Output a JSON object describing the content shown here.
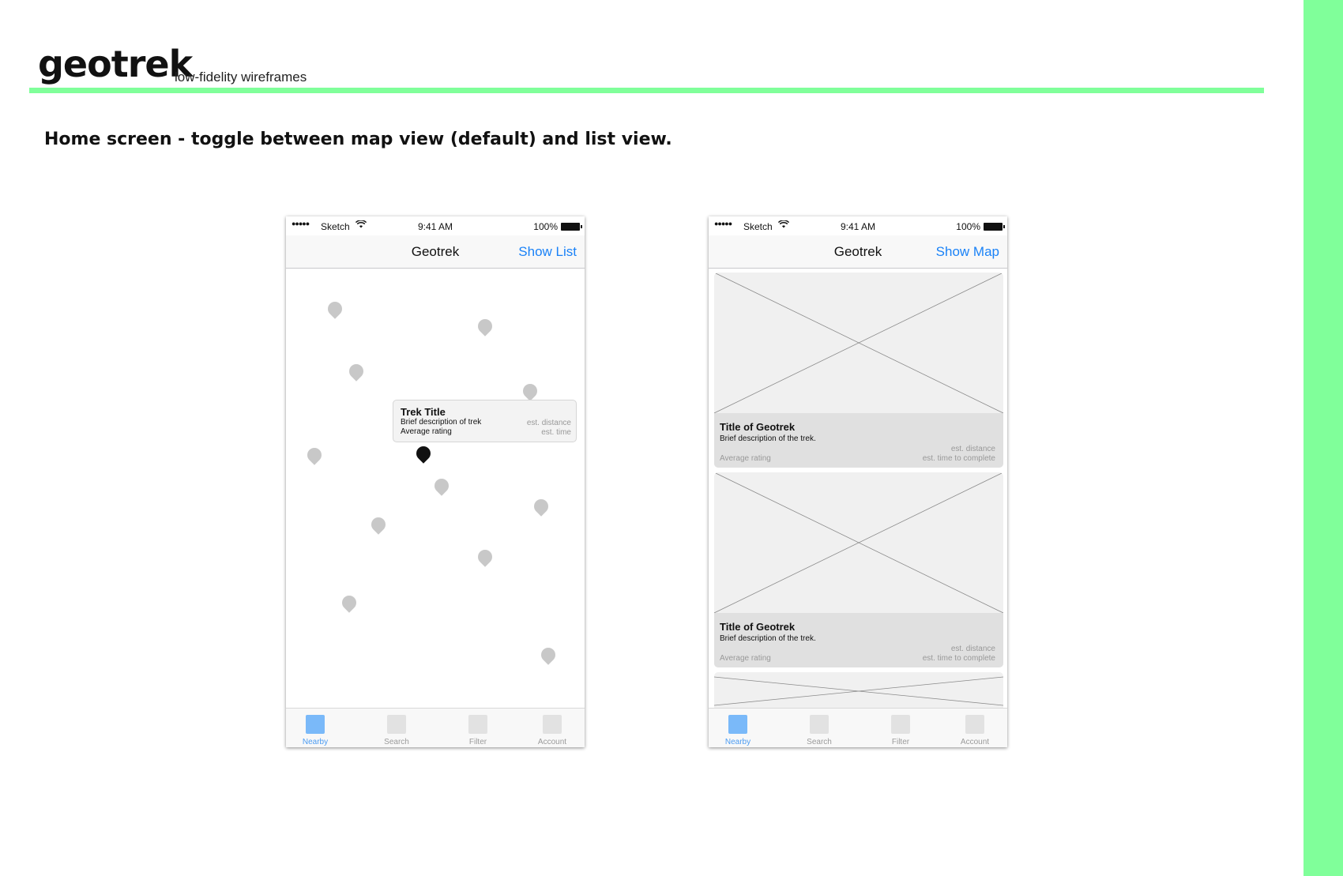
{
  "colors": {
    "accent_green": "#80ff9a",
    "ios_blue": "#1a82f7",
    "pin_gray": "#c8c8c8",
    "pin_active": "#111111",
    "tab_active": "#7ab9f9"
  },
  "header": {
    "logo": "geotrek",
    "subtitle": "low-fidelity wireframes"
  },
  "caption": "Home screen - toggle between map view (default) and list view.",
  "status_bar": {
    "signal": "●●●●●",
    "carrier": "Sketch",
    "time": "9:41 AM",
    "battery": "100%",
    "wifi_icon": "wifi-icon"
  },
  "map_screen": {
    "nav_title": "Geotrek",
    "nav_action": "Show List",
    "callout": {
      "title": "Trek Title",
      "description": "Brief description of trek",
      "rating": "Average rating",
      "distance": "est. distance",
      "time": "est. time"
    }
  },
  "list_screen": {
    "nav_title": "Geotrek",
    "nav_action": "Show Map",
    "cards": [
      {
        "title": "Title of Geotrek",
        "description": "Brief description of the trek.",
        "rating": "Average rating",
        "distance": "est. distance",
        "time": "est. time to complete"
      },
      {
        "title": "Title of Geotrek",
        "description": "Brief description of the trek.",
        "rating": "Average rating",
        "distance": "est. distance",
        "time": "est. time to complete"
      }
    ]
  },
  "tabs": [
    {
      "label": "Nearby",
      "icon": "nearby-icon",
      "active": true
    },
    {
      "label": "Search",
      "icon": "search-icon",
      "active": false
    },
    {
      "label": "Filter",
      "icon": "filter-icon",
      "active": false
    },
    {
      "label": "Account",
      "icon": "account-icon",
      "active": false
    }
  ]
}
